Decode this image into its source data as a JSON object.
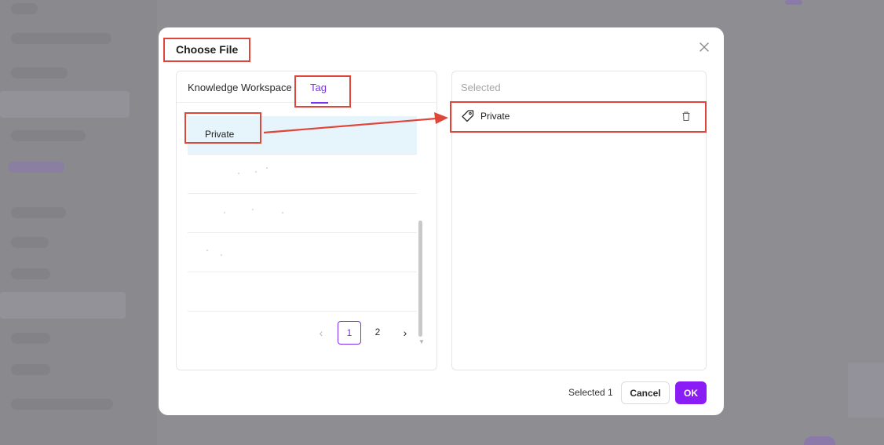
{
  "dialog": {
    "title": "Choose File",
    "tabs": [
      {
        "label": "Knowledge Workspace",
        "active": false
      },
      {
        "label": "Tag",
        "active": true
      }
    ],
    "rows": [
      {
        "label": "Private",
        "selected": true
      },
      {
        "label": "",
        "selected": false
      },
      {
        "label": "",
        "selected": false
      },
      {
        "label": "",
        "selected": false
      },
      {
        "label": "",
        "selected": false
      }
    ],
    "pagination": {
      "prev_icon": "chevron-left-icon",
      "pages": [
        "1",
        "2"
      ],
      "current": "1",
      "next_icon": "chevron-right-icon"
    },
    "selected_panel": {
      "header": "Selected",
      "items": [
        {
          "label": "Private",
          "icon": "tag-icon",
          "remove_icon": "trash-icon"
        }
      ]
    },
    "footer": {
      "count_text": "Selected 1",
      "cancel_label": "Cancel",
      "ok_label": "OK"
    },
    "close_icon": "close-icon"
  },
  "colors": {
    "accent": "#7b2ff2",
    "ok_button": "#8a1cf5",
    "annotation": "#e0453a",
    "selected_row": "#e6f4fb",
    "overlay": "#8b8a8f"
  }
}
